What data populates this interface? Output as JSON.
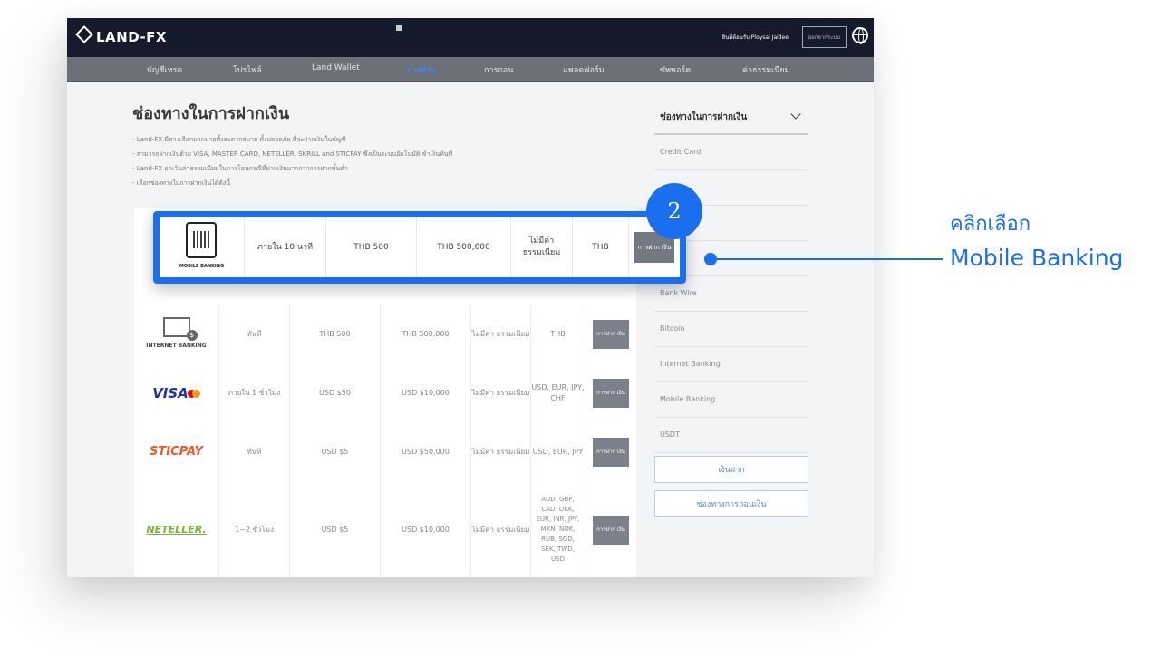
{
  "header": {
    "logo": "LAND-FX",
    "welcome": "ยินดีต้อนรับ Ploysai Jaidee",
    "logout_label": "ออกจากระบบ"
  },
  "nav": {
    "items": [
      "บัญชีเทรด",
      "โปรไฟล์",
      "Land Wallet",
      "การฝาก",
      "การถอน",
      "แพลตฟอร์ม",
      "ซัพพอร์ต",
      "ค่าธรรมเนียม"
    ]
  },
  "main": {
    "title": "ช่องทางในการฝากเงิน",
    "bullets": [
      "Land-FX มีทางเลือกมากมายทั้งสะดวกสบาย ทั้งปลอดภัย ที่จะฝากเงินในบัญชี",
      "สามารถฝากเงินด้วย VISA, MASTER CARD, NETELLER, SKRILL and STICPAY ซึ่งเป็นระบบอัตโนมัติเข้าเงินทันที",
      "Land-FX ยกเว้นค่าธรรมเนียมในการโอนกรณีที่ฝากเงินมากกว่าการฝากขั้นต่ำ",
      "เลือกช่องทางในการฝากเงินได้ดังนี้"
    ]
  },
  "highlight_row": {
    "method": "MOBILE BANKING",
    "time": "ภายใน 10 นาที",
    "min": "THB 500",
    "max": "THB 500,000",
    "fee": "ไม่มีค่า ธรรมเนียม",
    "currency": "THB",
    "button": "การฝาก เงิน"
  },
  "rows": [
    {
      "method": "INTERNET BANKING",
      "time": "ทันที",
      "min": "THB 500",
      "max": "THB 500,000",
      "fee": "ไม่มีค่า ธรรมเนียม",
      "currency": "THB",
      "button": "การฝาก เงิน"
    },
    {
      "method": "VISA",
      "time": "ภายใน 1 ชั่วโมง",
      "min": "USD $50",
      "max": "USD $10,000",
      "fee": "ไม่มีค่า ธรรมเนียม",
      "currency": "USD, EUR, JPY, CHF",
      "button": "การฝาก เงิน"
    },
    {
      "method": "STICPAY",
      "time": "ทันที",
      "min": "USD $5",
      "max": "USD $50,000",
      "fee": "ไม่มีค่า ธรรมเนียม",
      "currency": "USD, EUR, JPY",
      "button": "การฝาก เงิน"
    },
    {
      "method": "NETELLER.",
      "time": "1~2 ชั่วโมง",
      "min": "USD $5",
      "max": "USD $10,000",
      "fee": "ไม่มีค่า ธรรมเนียม",
      "currency": "AUD, GBP, CAD, DKK, EUR, INR, JPY, MXN, NOK, RUB, SGD, SEK, TWD, USD",
      "button": "การฝาก เงิน"
    }
  ],
  "sidebar": {
    "heading": "ช่องทางในการฝากเงิน",
    "items": [
      "Credit Card",
      "Bank Wire",
      "Bitcoin",
      "Internet Banking",
      "Mobile Banking",
      "USDT"
    ],
    "btn_deposit": "เงินฝาก",
    "btn_withdraw": "ช่องทางการถอนเงิน"
  },
  "annotation": {
    "step": "2",
    "line1": "คลิกเลือก",
    "line2": "Mobile Banking"
  },
  "colors": {
    "accent": "#1a6ff0",
    "header_bg": "#161b2b",
    "nav_bg": "#6d7078"
  }
}
